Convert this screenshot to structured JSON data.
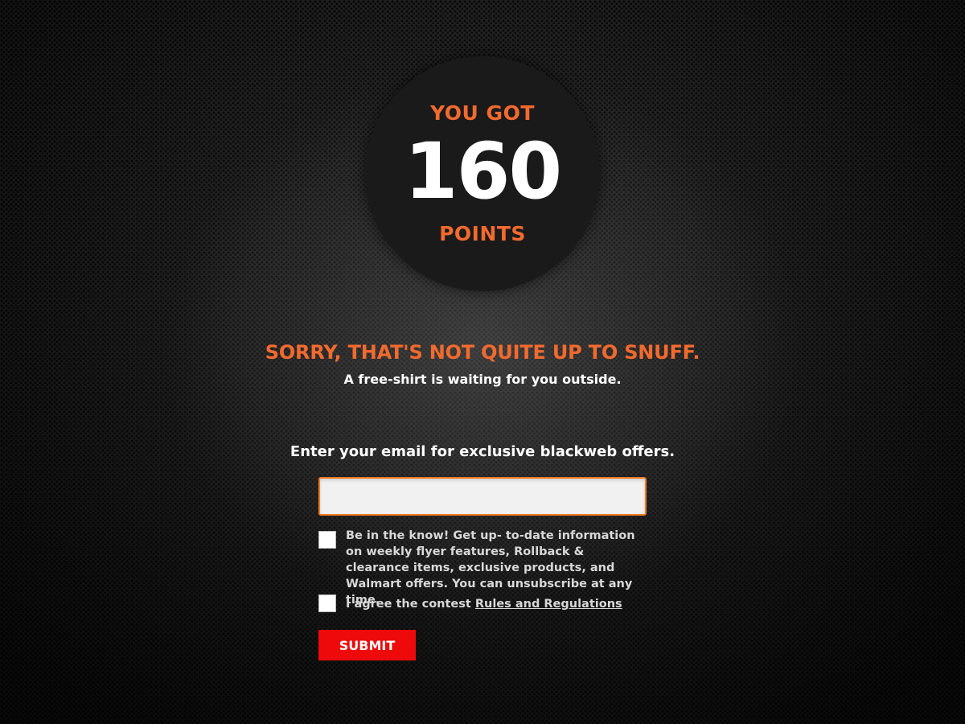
{
  "score": {
    "top_label": "YOU GOT",
    "value": "160",
    "bottom_label": "POINTS"
  },
  "result": {
    "headline": "SORRY, THAT'S NOT QUITE UP TO SNUFF.",
    "subline": "A free-shirt is waiting for you outside."
  },
  "form": {
    "prompt": "Enter your email for exclusive blackweb offers.",
    "email_value": "",
    "newsletter_text": "Be in the know! Get up- to-date information on weekly flyer features, Rollback & clearance items, exclusive products, and Walmart offers. You can unsubscribe at any time.",
    "rules_text": "I agree the contest ",
    "rules_link": "Rules and Regulations",
    "submit_label": "SUBMIT"
  },
  "colors": {
    "accent_orange": "#f26a2e",
    "submit_red": "#ee0a0a",
    "input_border": "#f07a22"
  }
}
